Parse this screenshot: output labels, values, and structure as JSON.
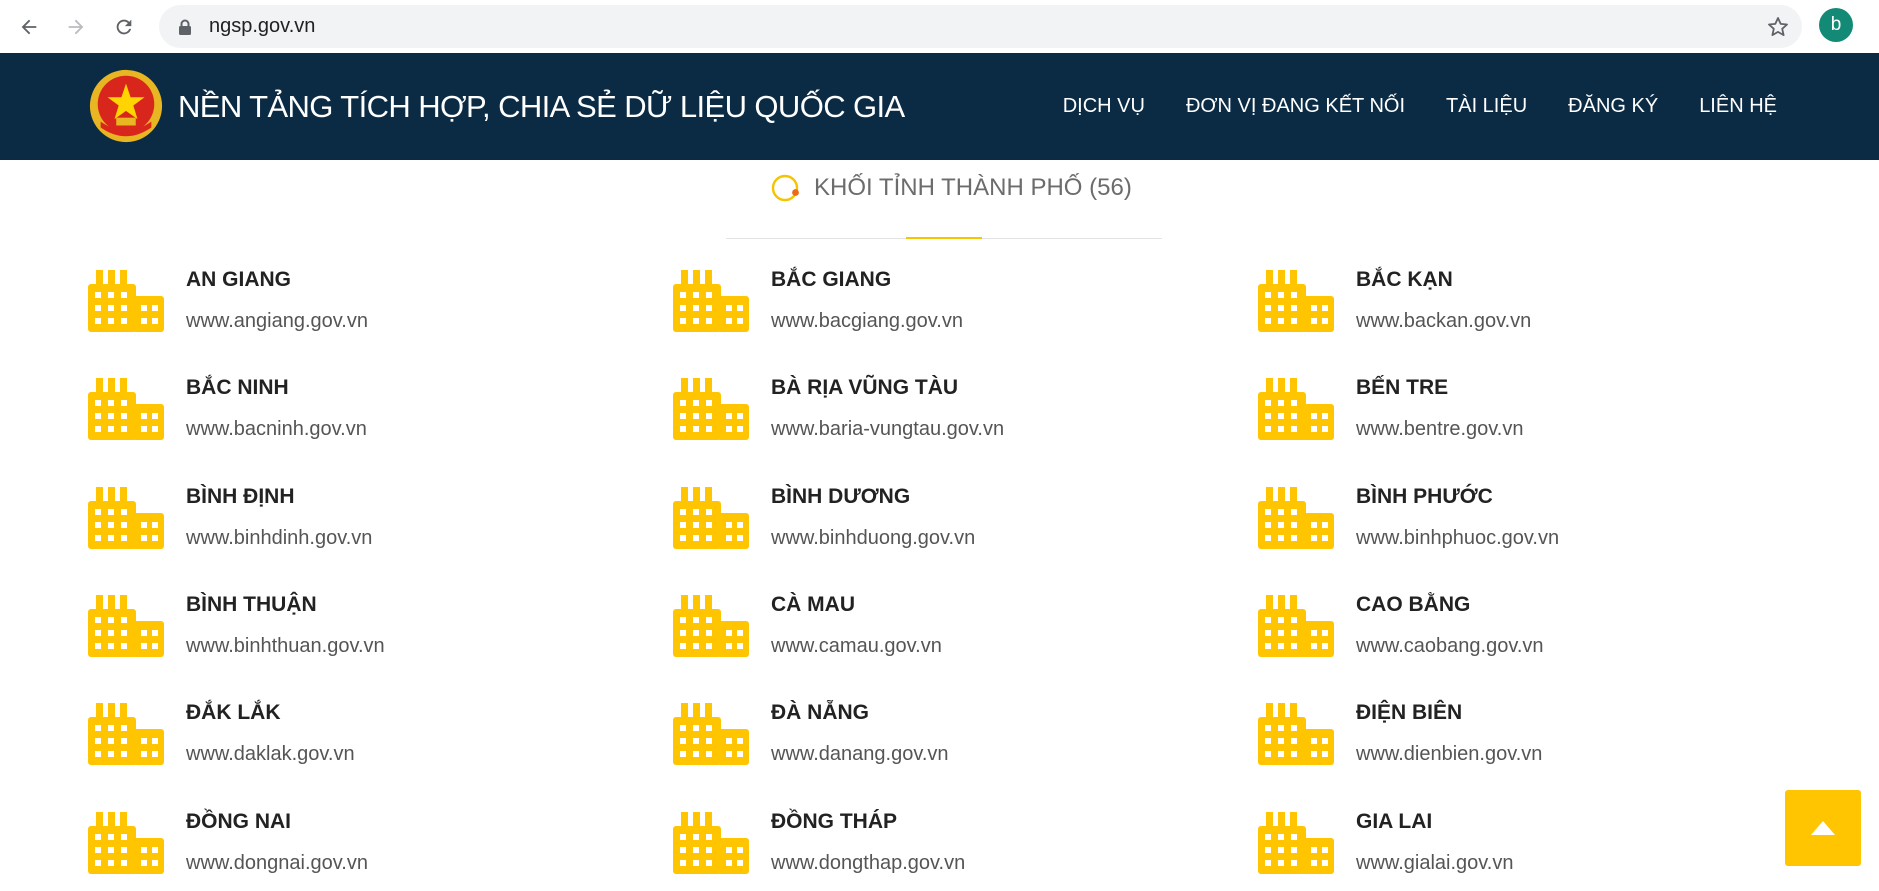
{
  "browser": {
    "url": "ngsp.gov.vn",
    "profile_initial": "b"
  },
  "header": {
    "title": "NỀN TẢNG TÍCH HỢP, CHIA SẺ DỮ LIỆU QUỐC GIA",
    "nav": [
      "DỊCH VỤ",
      "ĐƠN VỊ ĐANG KẾT NỐI",
      "TÀI LIỆU",
      "ĐĂNG KÝ",
      "LIÊN HỆ"
    ]
  },
  "section": {
    "title": "KHỐI TỈNH THÀNH PHỐ (56)"
  },
  "provinces": [
    {
      "name": "AN GIANG",
      "site": "www.angiang.gov.vn"
    },
    {
      "name": "BẮC GIANG",
      "site": "www.bacgiang.gov.vn"
    },
    {
      "name": "BẮC KẠN",
      "site": "www.backan.gov.vn"
    },
    {
      "name": "BẮC NINH",
      "site": "www.bacninh.gov.vn"
    },
    {
      "name": "BÀ RỊA VŨNG TÀU",
      "site": "www.baria-vungtau.gov.vn"
    },
    {
      "name": "BẾN TRE",
      "site": "www.bentre.gov.vn"
    },
    {
      "name": "BÌNH ĐỊNH",
      "site": "www.binhdinh.gov.vn"
    },
    {
      "name": "BÌNH DƯƠNG",
      "site": "www.binhduong.gov.vn"
    },
    {
      "name": "BÌNH PHƯỚC",
      "site": "www.binhphuoc.gov.vn"
    },
    {
      "name": "BÌNH THUẬN",
      "site": "www.binhthuan.gov.vn"
    },
    {
      "name": "CÀ MAU",
      "site": "www.camau.gov.vn"
    },
    {
      "name": "CAO BẰNG",
      "site": "www.caobang.gov.vn"
    },
    {
      "name": "ĐẮK LẮK",
      "site": "www.daklak.gov.vn"
    },
    {
      "name": "ĐÀ NẴNG",
      "site": "www.danang.gov.vn"
    },
    {
      "name": "ĐIỆN BIÊN",
      "site": "www.dienbien.gov.vn"
    },
    {
      "name": "ĐỒNG NAI",
      "site": "www.dongnai.gov.vn"
    },
    {
      "name": "ĐỒNG THÁP",
      "site": "www.dongthap.gov.vn"
    },
    {
      "name": "GIA LAI",
      "site": "www.gialai.gov.vn"
    }
  ],
  "icons": {
    "province": "building-icon",
    "scroll_top": "arrow-up-icon",
    "section": "spinner-icon"
  },
  "colors": {
    "header_bg": "#0b2b45",
    "accent": "#ffc500",
    "building": "#ffc500"
  }
}
